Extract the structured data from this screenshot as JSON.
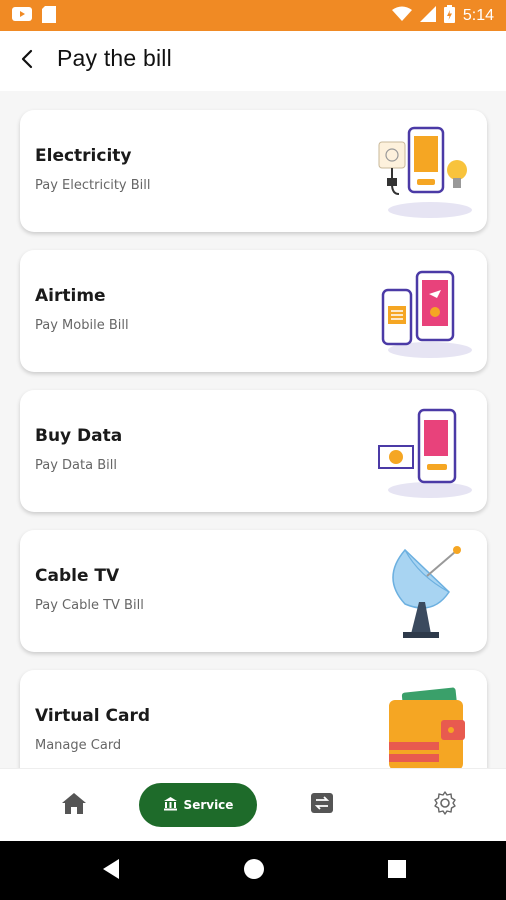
{
  "status_bar": {
    "time": "5:14",
    "icons": [
      "youtube-icon",
      "sd-card-icon",
      "wifi-icon",
      "signal-icon",
      "battery-icon"
    ]
  },
  "header": {
    "title": "Pay the bill",
    "back_icon": "back-arrow-icon"
  },
  "services": [
    {
      "title": "Electricity",
      "subtitle": "Pay Electricity Bill",
      "illustration": "electricity-illustration"
    },
    {
      "title": "Airtime",
      "subtitle": "Pay Mobile Bill",
      "illustration": "airtime-illustration"
    },
    {
      "title": "Buy Data",
      "subtitle": "Pay Data Bill",
      "illustration": "data-illustration"
    },
    {
      "title": "Cable TV",
      "subtitle": "Pay Cable TV Bill",
      "illustration": "satellite-dish-illustration"
    },
    {
      "title": "Virtual Card",
      "subtitle": "Manage Card",
      "illustration": "wallet-illustration"
    }
  ],
  "bottom_nav": {
    "items": [
      {
        "name": "home",
        "icon": "home-icon",
        "active": false
      },
      {
        "name": "service",
        "icon": "bank-icon",
        "label": "Service",
        "active": true
      },
      {
        "name": "transfer",
        "icon": "transfer-icon",
        "active": false
      },
      {
        "name": "settings",
        "icon": "gear-icon",
        "active": false
      }
    ]
  },
  "colors": {
    "status_bar": "#f08a24",
    "accent_green": "#1e6b2a",
    "illustration_purple": "#4b3aa6",
    "illustration_orange": "#f5a623",
    "illustration_pink": "#e8427b"
  }
}
